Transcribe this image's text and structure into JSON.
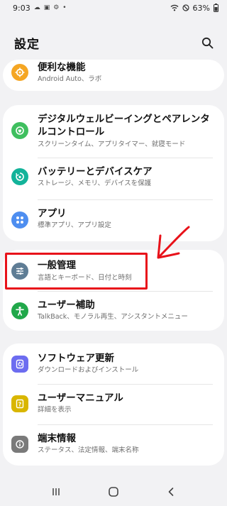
{
  "status": {
    "time": "9:03",
    "battery": "63%"
  },
  "header": {
    "title": "設定"
  },
  "card_top": {
    "item": {
      "title": "便利な機能",
      "subtitle": "Android Auto、ラボ"
    }
  },
  "card_a": [
    {
      "title_line1": "デジタルウェルビーイングとペアレンタ",
      "title_line2": "ルコントロール",
      "subtitle": "スクリーンタイム、アプリタイマー、就寝モード"
    },
    {
      "title": "バッテリーとデバイスケア",
      "subtitle": "ストレージ、メモリ、デバイスを保護"
    },
    {
      "title": "アプリ",
      "subtitle": "標準アプリ、アプリ設定"
    }
  ],
  "card_b": [
    {
      "title": "一般管理",
      "subtitle": "言語とキーボード、日付と時刻"
    },
    {
      "title": "ユーザー補助",
      "subtitle": "TalkBack、モノラル再生、アシスタントメニュー"
    }
  ],
  "card_c": [
    {
      "title": "ソフトウェア更新",
      "subtitle": "ダウンロードおよびインストール"
    },
    {
      "title": "ユーザーマニュアル",
      "subtitle": "詳細を表示"
    },
    {
      "title": "端末情報",
      "subtitle": "ステータス、法定情報、端末名称"
    }
  ],
  "colors": {
    "highlight": "#e8121a",
    "arrow": "#e8121a",
    "convenience_icon": "#f5a623",
    "wellbeing_icon": "#3fbf5f",
    "battery_icon": "#13b39a",
    "apps_icon": "#4e8ef0",
    "general_icon": "#5f7d95",
    "accessibility_icon": "#21a84a",
    "update_icon": "#6c6cf0",
    "manual_icon": "#d9b600",
    "about_icon": "#7a7a7a"
  },
  "icons": {
    "convenience": "gear-plus-icon",
    "wellbeing": "heart-leaf-icon",
    "battery": "refresh-battery-icon",
    "apps": "four-dots-icon",
    "general": "sliders-icon",
    "accessibility": "person-icon",
    "update": "update-arrow-icon",
    "manual": "book-question-icon",
    "about": "info-icon"
  }
}
